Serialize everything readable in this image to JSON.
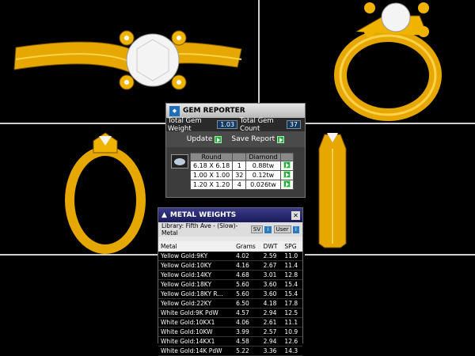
{
  "gem_reporter": {
    "title": "GEM REPORTER",
    "total_weight_label": "Total Gem Weight",
    "total_weight_value": "1.03",
    "total_count_label": "Total Gem Count",
    "total_count_value": "37",
    "update_label": "Update",
    "save_report_label": "Save Report",
    "columns": [
      "Round",
      "",
      "Diamond"
    ],
    "rows": [
      {
        "size": "6.18 X 6.18",
        "count": "1",
        "weight": "0.88tw"
      },
      {
        "size": "1.00 X 1.00",
        "count": "32",
        "weight": "0.12tw"
      },
      {
        "size": "1.20 X 1.20",
        "count": "4",
        "weight": "0.026tw"
      }
    ]
  },
  "metal_weights": {
    "title": "METAL WEIGHTS",
    "library": "Library: Fifth Ave - (Slow)-Metal",
    "sv_label": "SV",
    "user_label": "User",
    "headers": [
      "Metal",
      "Grams",
      "DWT",
      "SPG"
    ],
    "rows": [
      {
        "metal": "Yellow Gold:9KY",
        "grams": "4.02",
        "dwt": "2.59",
        "spg": "11.0"
      },
      {
        "metal": "Yellow Gold:10KY",
        "grams": "4.16",
        "dwt": "2.67",
        "spg": "11.4"
      },
      {
        "metal": "Yellow Gold:14KY",
        "grams": "4.68",
        "dwt": "3.01",
        "spg": "12.8"
      },
      {
        "metal": "Yellow Gold:18KY",
        "grams": "5.60",
        "dwt": "3.60",
        "spg": "15.4"
      },
      {
        "metal": "Yellow Gold:18KY R...",
        "grams": "5.60",
        "dwt": "3.60",
        "spg": "15.4"
      },
      {
        "metal": "Yellow Gold:22KY",
        "grams": "6.50",
        "dwt": "4.18",
        "spg": "17.8"
      },
      {
        "metal": "White Gold:9K PdW",
        "grams": "4.57",
        "dwt": "2.94",
        "spg": "12.5"
      },
      {
        "metal": "White Gold:10KX1",
        "grams": "4.06",
        "dwt": "2.61",
        "spg": "11.1"
      },
      {
        "metal": "White Gold:10KW",
        "grams": "3.99",
        "dwt": "2.57",
        "spg": "10.9"
      },
      {
        "metal": "White Gold:14KX1",
        "grams": "4.58",
        "dwt": "2.94",
        "spg": "12.6"
      },
      {
        "metal": "White Gold:14K PdW",
        "grams": "5.22",
        "dwt": "3.36",
        "spg": "14.3"
      }
    ]
  },
  "colors": {
    "gold": "#f0b400",
    "gold_dark": "#b07a00",
    "gem": "#f4f4f4",
    "background": "#000000"
  }
}
